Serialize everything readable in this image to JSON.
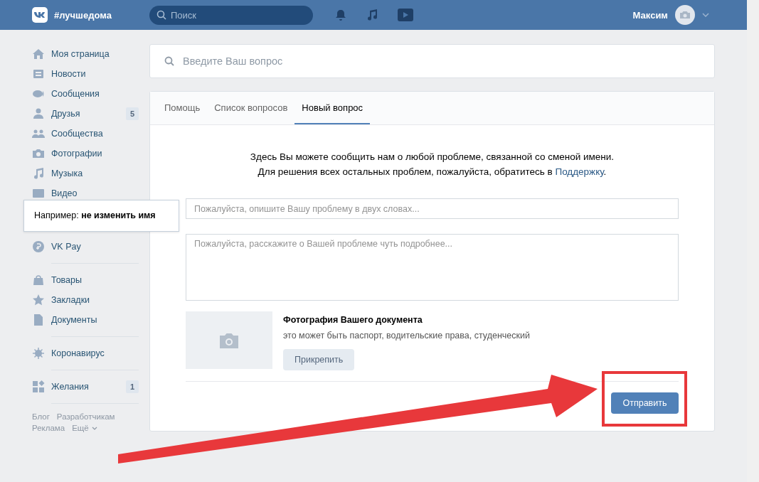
{
  "header": {
    "logo_text": "#лучшедома",
    "search_placeholder": "Поиск",
    "user_name": "Максим"
  },
  "sidebar": {
    "groups": [
      {
        "items": [
          {
            "label": "Моя страница"
          },
          {
            "label": "Новости"
          },
          {
            "label": "Сообщения"
          },
          {
            "label": "Друзья",
            "badge": "5"
          },
          {
            "label": "Сообщества"
          },
          {
            "label": "Фотографии"
          },
          {
            "label": "Музыка"
          },
          {
            "label": "Видео"
          }
        ]
      },
      {
        "items": [
          {
            "label": "VK Pay"
          }
        ]
      },
      {
        "items": [
          {
            "label": "Товары"
          },
          {
            "label": "Закладки"
          },
          {
            "label": "Документы"
          }
        ]
      },
      {
        "items": [
          {
            "label": "Коронавирус"
          }
        ]
      },
      {
        "items": [
          {
            "label": "Желания",
            "badge": "1"
          }
        ]
      }
    ],
    "footer_links": [
      "Блог",
      "Разработчикам",
      "Реклама",
      "Ещё"
    ]
  },
  "tooltip": "Например: **не изменить имя**",
  "main": {
    "search_placeholder": "Введите Ваш вопрос",
    "tabs": [
      {
        "label": "Помощь",
        "selected": false
      },
      {
        "label": "Список вопросов",
        "selected": false
      },
      {
        "label": "Новый вопрос",
        "selected": true
      }
    ],
    "intro": "Здесь Вы можете сообщить нам о любой проблеме, связанной со сменой имени.",
    "support_line": {
      "text": "Для решения всех остальных проблем, пожалуйста, обратитесь в ",
      "link": "Поддержку",
      "after": "."
    },
    "title_placeholder": "Пожалуйста, опишите Вашу проблему в двух словах...",
    "details_placeholder": "Пожалуйста, расскажите о Вашей проблеме чуть подробнее...",
    "attachment": {
      "title": "Фотография Вашего документа",
      "hint": "это может быть паспорт, водительские права, студенческий",
      "button": "Прикрепить"
    },
    "submit": "Отправить"
  }
}
